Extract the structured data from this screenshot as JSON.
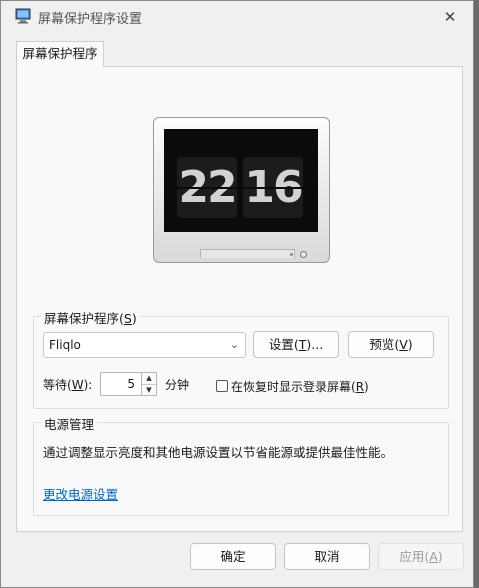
{
  "window": {
    "title": "屏幕保护程序设置",
    "close_glyph": "✕"
  },
  "tab": {
    "label": "屏幕保护程序"
  },
  "preview": {
    "clock_hours": "22",
    "clock_minutes": "16"
  },
  "screensaver_group": {
    "label": "屏幕保护程序",
    "label_hotkey": "S",
    "selected_screensaver": "Fliqlo",
    "settings_button": "设置",
    "settings_hotkey": "T",
    "settings_suffix": "...",
    "preview_button": "预览",
    "preview_hotkey": "V",
    "wait_label": "等待",
    "wait_hotkey": "W",
    "wait_value": "5",
    "wait_unit": "分钟",
    "resume_checkbox_label": "在恢复时显示登录屏幕",
    "resume_hotkey": "R",
    "resume_checked": false
  },
  "power_group": {
    "label": "电源管理",
    "description": "通过调整显示亮度和其他电源设置以节省能源或提供最佳性能。",
    "link": "更改电源设置"
  },
  "footer": {
    "ok": "确定",
    "cancel": "取消",
    "apply": "应用",
    "apply_hotkey": "A"
  }
}
